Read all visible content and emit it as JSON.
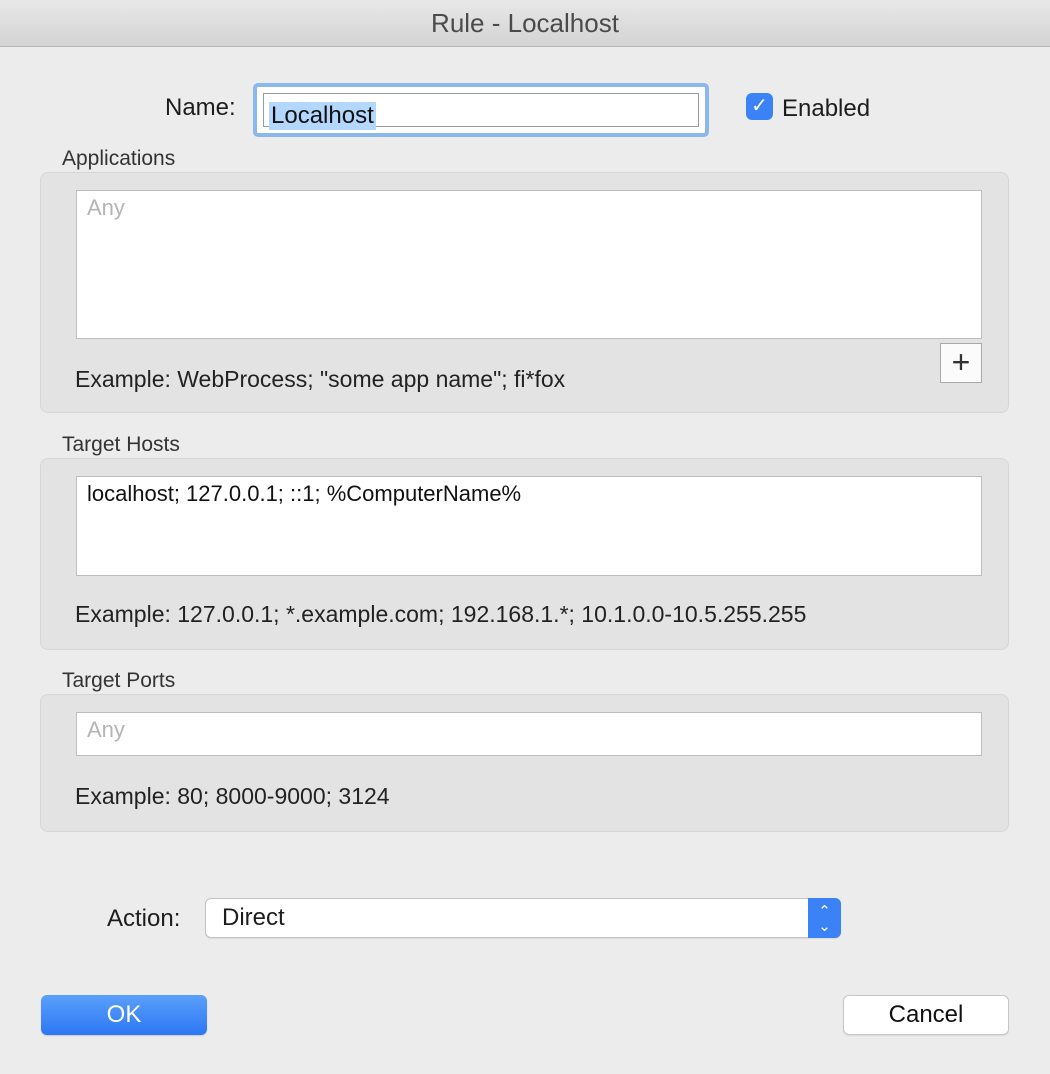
{
  "window": {
    "title": "Rule - Localhost"
  },
  "name": {
    "label": "Name:",
    "value": "Localhost"
  },
  "enabled": {
    "label": "Enabled",
    "checked": true,
    "check_glyph": "✓"
  },
  "applications": {
    "label": "Applications",
    "placeholder": "Any",
    "example": "Example: WebProcess; \"some app name\"; fi*fox",
    "add_glyph": "+"
  },
  "target_hosts": {
    "label": "Target Hosts",
    "value": "localhost; 127.0.0.1; ::1; %ComputerName%",
    "example": "Example: 127.0.0.1; *.example.com; 192.168.1.*; 10.1.0.0-10.5.255.255"
  },
  "target_ports": {
    "label": "Target Ports",
    "placeholder": "Any",
    "example": "Example: 80; 8000-9000; 3124"
  },
  "action": {
    "label": "Action:",
    "value": "Direct",
    "arrow_up": "⌃",
    "arrow_down": "⌄"
  },
  "buttons": {
    "ok": "OK",
    "cancel": "Cancel"
  },
  "colors": {
    "accent": "#3b82f6",
    "selection": "#b3d7ff",
    "window_bg": "#ececec"
  }
}
